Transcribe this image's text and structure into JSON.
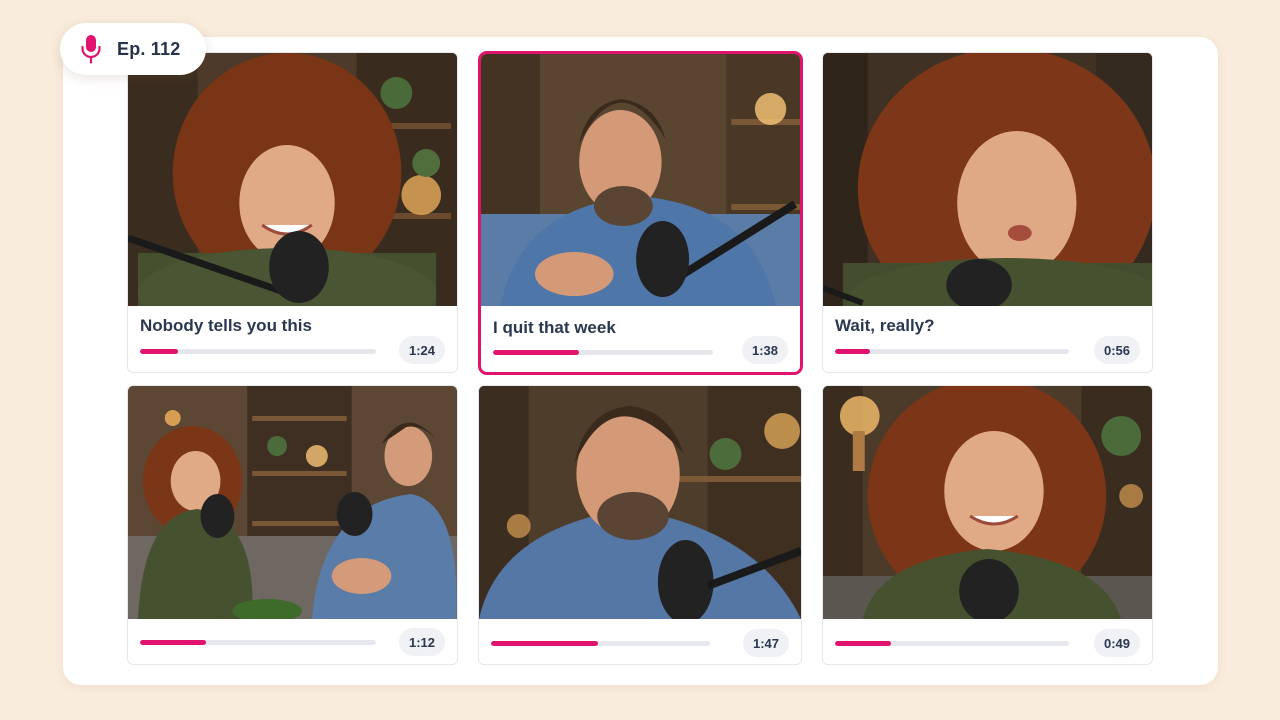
{
  "episode": {
    "label": "Ep. 112",
    "icon": "microphone-icon",
    "accent": "#e0146e"
  },
  "clips": [
    {
      "caption": "Nobody tells you this",
      "duration": "1:24",
      "progress": 0.16,
      "selected": false,
      "scene": "woman-laughing"
    },
    {
      "caption": "I quit that week",
      "duration": "1:38",
      "progress": 0.39,
      "selected": true,
      "scene": "man-talking-gesturing"
    },
    {
      "caption": "Wait, really?",
      "duration": "0:56",
      "progress": 0.15,
      "selected": false,
      "scene": "woman-surprised"
    },
    {
      "caption": "",
      "duration": "1:12",
      "progress": 0.28,
      "selected": false,
      "scene": "both-hosts-wide"
    },
    {
      "caption": "",
      "duration": "1:47",
      "progress": 0.49,
      "selected": false,
      "scene": "man-closeup"
    },
    {
      "caption": "",
      "duration": "0:49",
      "progress": 0.24,
      "selected": false,
      "scene": "woman-smiling"
    }
  ]
}
